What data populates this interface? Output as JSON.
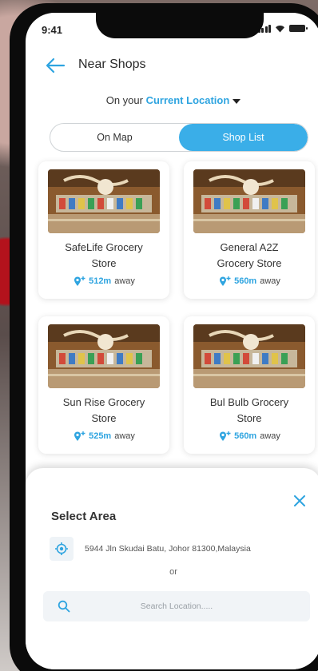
{
  "status": {
    "time": "9:41"
  },
  "header": {
    "title": "Near Shops"
  },
  "location": {
    "prefix": "On your ",
    "link": "Current Location"
  },
  "tabs": [
    {
      "label": "On Map",
      "active": false
    },
    {
      "label": "Shop List",
      "active": true
    }
  ],
  "shops": [
    {
      "name_line1": "SafeLife Grocery",
      "name_line2": "Store",
      "distance": "512m",
      "suffix": "away"
    },
    {
      "name_line1": "General A2Z",
      "name_line2": "Grocery Store",
      "distance": "560m",
      "suffix": "away"
    },
    {
      "name_line1": "Sun Rise Grocery",
      "name_line2": "Store",
      "distance": "525m",
      "suffix": "away"
    },
    {
      "name_line1": "Bul Bulb Grocery",
      "name_line2": "Store",
      "distance": "560m",
      "suffix": "away"
    }
  ],
  "sheet": {
    "title": "Select Area",
    "address": "5944 Jln Skudai Batu, Johor 81300,Malaysia",
    "or_label": "or",
    "search_placeholder": "Search Location....."
  },
  "colors": {
    "accent": "#3aaee8",
    "link": "#2ea4e0"
  },
  "icons": {
    "back": "back-arrow-icon",
    "caret": "caret-down-icon",
    "pin": "location-pin-icon",
    "close": "close-icon",
    "target": "gps-target-icon",
    "search": "search-icon"
  }
}
